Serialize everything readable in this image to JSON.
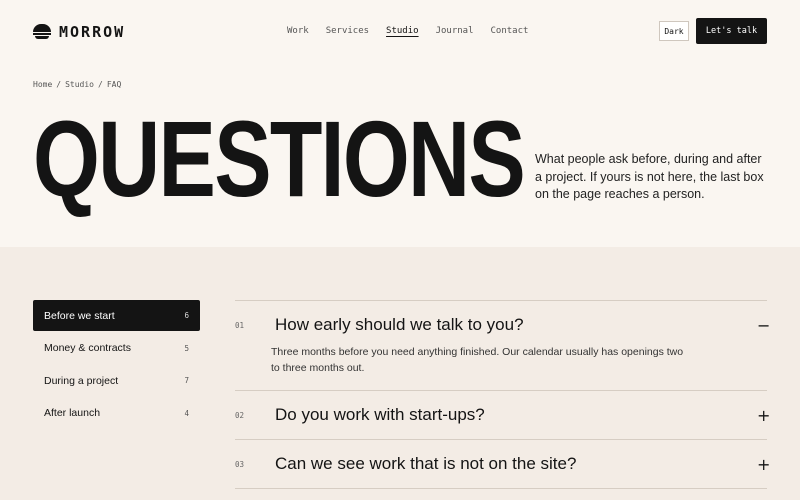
{
  "brand": {
    "name": "MORROW",
    "logo_icon": "hat-icon"
  },
  "nav": [
    {
      "label": "Work",
      "active": false
    },
    {
      "label": "Services",
      "active": false
    },
    {
      "label": "Studio",
      "active": true
    },
    {
      "label": "Journal",
      "active": false
    },
    {
      "label": "Contact",
      "active": false
    }
  ],
  "header": {
    "theme_toggle": "Dark",
    "cta": "Let's talk"
  },
  "breadcrumb": [
    "Home",
    "Studio",
    "FAQ"
  ],
  "hero": {
    "title": "QUESTIONS",
    "description": "What people ask before, during and after a project. If yours is not here, the last box on the page reaches a person."
  },
  "sidebar": [
    {
      "label": "Before we start",
      "count": "6",
      "active": true
    },
    {
      "label": "Money & contracts",
      "count": "5",
      "active": false
    },
    {
      "label": "During a project",
      "count": "7",
      "active": false
    },
    {
      "label": "After launch",
      "count": "4",
      "active": false
    }
  ],
  "faq": [
    {
      "num": "01",
      "question": "How early should we talk to you?",
      "icon": "−",
      "expanded": true,
      "answer": "Three months before you need anything finished. Our calendar usually has openings two to three months out."
    },
    {
      "num": "02",
      "question": "Do you work with start-ups?",
      "icon": "+",
      "expanded": false,
      "answer": ""
    },
    {
      "num": "03",
      "question": "Can we see work that is not on the site?",
      "icon": "+",
      "expanded": false,
      "answer": ""
    }
  ]
}
